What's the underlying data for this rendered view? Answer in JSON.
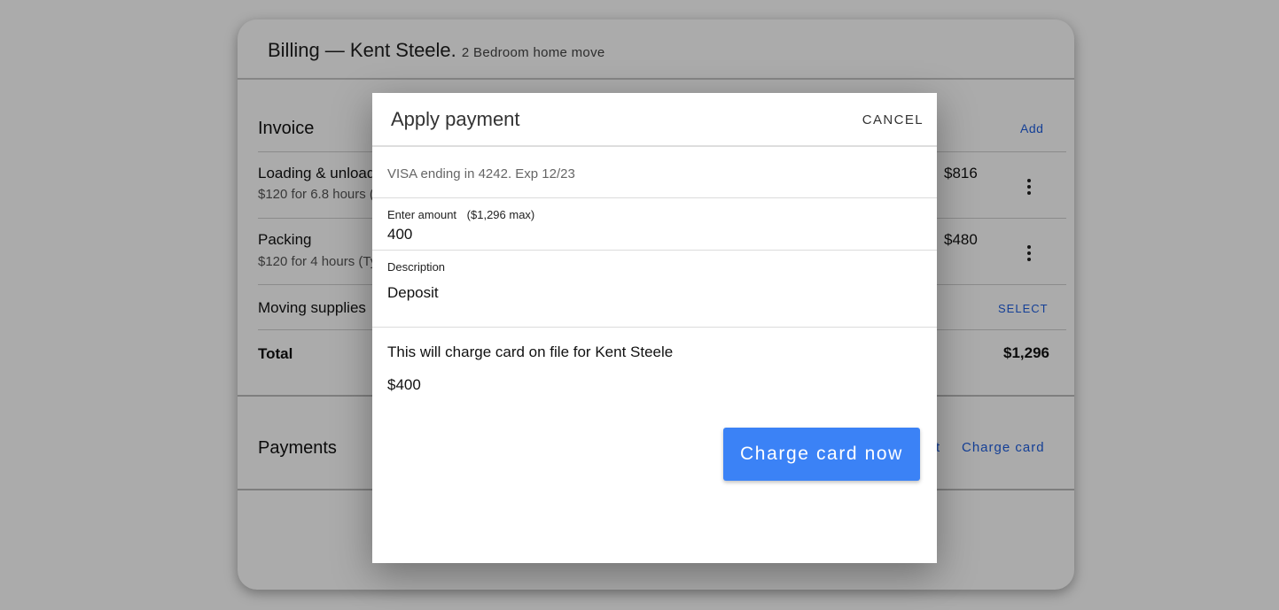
{
  "billing": {
    "title": "Billing — Kent Steele.",
    "subtitle": "2 Bedroom home move"
  },
  "invoice": {
    "heading": "Invoice",
    "add_label": "Add",
    "items": [
      {
        "name": "Loading & unload",
        "detail": "$120 for 6.8 hours (",
        "amount": "$816"
      },
      {
        "name": "Packing",
        "detail": "$120 for 4 hours (Ty",
        "amount": "$480"
      }
    ],
    "supplies_label": "Moving supplies",
    "select_label": "SELECT",
    "total_label": "Total",
    "total_value": "$1,296"
  },
  "payments": {
    "heading": "Payments",
    "partial_link": "t",
    "charge_card_label": "Charge card"
  },
  "dialog": {
    "title": "Apply payment",
    "cancel_label": "CANCEL",
    "card_info": "VISA ending in 4242. Exp 12/23",
    "amount_label": "Enter amount",
    "amount_max": "($1,296 max)",
    "amount_value": "400",
    "description_label": "Description",
    "description_value": "Deposit",
    "charge_notice": "This will charge card on file for Kent Steele",
    "charge_amount": "$400",
    "charge_button": "Charge card now"
  },
  "colors": {
    "accent": "#3b82f6",
    "link": "#1f5fe0"
  }
}
